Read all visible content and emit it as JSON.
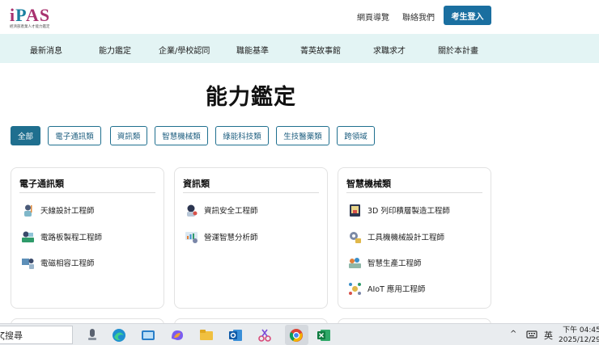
{
  "header": {
    "logo_text": "iPAS",
    "logo_subtitle": "經濟部產業人才能力鑑定",
    "links": [
      "網頁導覽",
      "聯絡我們"
    ],
    "login_label": "考生登入"
  },
  "nav": {
    "items": [
      "最新消息",
      "能力鑑定",
      "企業/學校認同",
      "職能基準",
      "菁英故事館",
      "求職求才",
      "關於本計畫"
    ]
  },
  "main": {
    "title": "能力鑑定",
    "filters": [
      "全部",
      "電子通訊類",
      "資訊類",
      "智慧機械類",
      "綠能科技類",
      "生技醫藥類",
      "跨領域"
    ],
    "active_filter": "全部",
    "cards": [
      {
        "title": "電子通訊類",
        "jobs": [
          "天線設計工程師",
          "電路板製程工程師",
          "電磁相容工程師"
        ]
      },
      {
        "title": "資訊類",
        "jobs": [
          "資訊安全工程師",
          "營運智慧分析師"
        ]
      },
      {
        "title": "智慧機械類",
        "jobs": [
          "3D 列印積層製造工程師",
          "工具機機械設計工程師",
          "智慧生產工程師",
          "AIoT 應用工程師"
        ]
      }
    ]
  },
  "taskbar": {
    "search_text": "ζ搜尋",
    "icons": [
      "copilot-mic-icon",
      "edge-icon",
      "photos-icon",
      "copilot-icon",
      "file-explorer-icon",
      "outlook-icon",
      "snipping-icon",
      "chrome-icon",
      "excel-icon"
    ],
    "tray": {
      "chevron": "^",
      "language": "英"
    },
    "clock": {
      "time": "下午 04:45",
      "date": "2025/12/29"
    }
  },
  "colors": {
    "accent": "#1f6f8f",
    "nav_bg": "#e3f4f4",
    "logo": "#a8326f",
    "login": "#1a6fa0"
  }
}
